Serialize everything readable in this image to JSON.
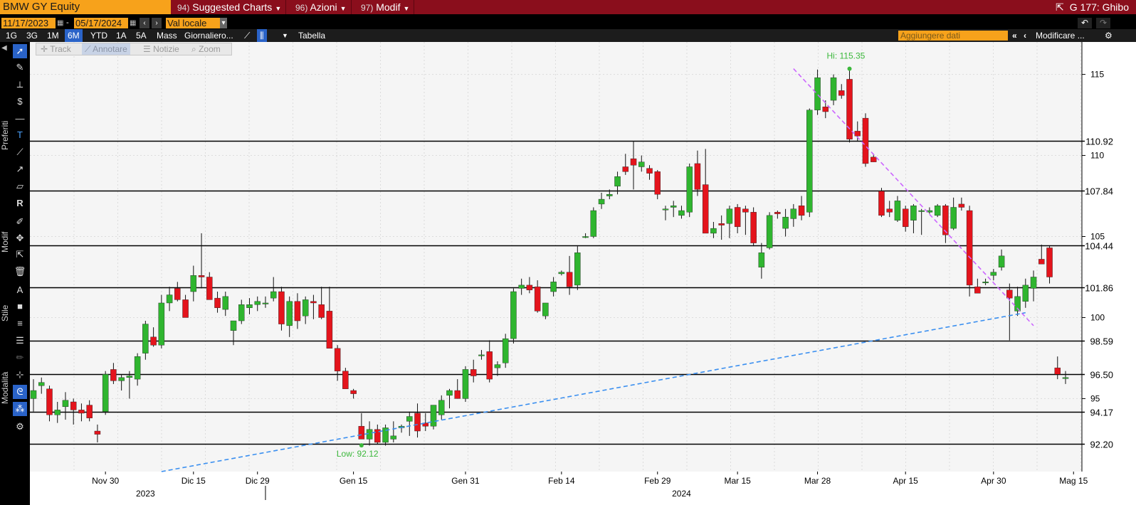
{
  "header": {
    "ticker": "BMW GY Equity",
    "menus": [
      {
        "num": "94)",
        "label": "Suggested Charts"
      },
      {
        "num": "96)",
        "label": "Azioni"
      },
      {
        "num": "97)",
        "label": "Modif"
      }
    ],
    "right_title": "G 177: Ghibo"
  },
  "range": {
    "start": "11/17/2023",
    "end": "05/17/2024",
    "currency": "Val locale"
  },
  "timeframes": [
    "1G",
    "3G",
    "1M",
    "6M",
    "YTD",
    "1A",
    "5A",
    "Mass"
  ],
  "active_timeframe": "6M",
  "periodicity": "Giornaliero...",
  "table_label": "Tabella",
  "add_data_placeholder": "Aggiungere dati",
  "modify_label": "Modificare ...",
  "float_toolbar": [
    "Track",
    "Annotare",
    "Notizie",
    "Zoom"
  ],
  "left_sections": [
    "Preferiti",
    "Modif",
    "Stile",
    "Modalità"
  ],
  "colors": {
    "up": "#2fb52f",
    "down": "#e4141c",
    "trend_down": "#cc66ff",
    "trend_up": "#3a8ff0",
    "hi_lo_label": "#3cb83c",
    "accent": "#f7a21b",
    "header_red": "#8a0e1c",
    "selected": "#2a63c8"
  },
  "chart_data": {
    "type": "candlestick",
    "y_range": [
      90.5,
      117
    ],
    "y_ticks": [
      95,
      100,
      105,
      110,
      115
    ],
    "x_ticks": [
      "Nov 30",
      "Dic 15",
      "Dic 29",
      "Gen 15",
      "Gen 31",
      "Feb 14",
      "Feb 29",
      "Mar 15",
      "Mar 28",
      "Apr 15",
      "Apr 30",
      "Mag 15"
    ],
    "years": [
      "2023",
      "2024"
    ],
    "hi_label": "Hi: 115.35",
    "lo_label": "Low: 92.12",
    "levels": [
      110.92,
      107.84,
      104.44,
      101.86,
      98.59,
      96.5,
      94.17,
      92.2
    ],
    "trendlines": [
      {
        "name": "resistance",
        "from": [
          95,
          115.35
        ],
        "to": [
          125,
          99.5
        ]
      },
      {
        "name": "support",
        "from": [
          16,
          90.5
        ],
        "to": [
          124,
          100.3
        ]
      }
    ],
    "candles": [
      [
        95.0,
        96.2,
        94.2,
        95.5
      ],
      [
        95.8,
        96.3,
        95.3,
        96.0
      ],
      [
        95.6,
        95.8,
        93.6,
        94.0
      ],
      [
        94.0,
        94.8,
        93.5,
        94.3
      ],
      [
        94.5,
        95.4,
        93.7,
        94.9
      ],
      [
        94.8,
        95.0,
        93.4,
        94.3
      ],
      [
        94.3,
        94.7,
        93.6,
        94.1
      ],
      [
        94.6,
        94.9,
        93.6,
        93.8
      ],
      [
        93.0,
        93.4,
        92.3,
        92.8
      ],
      [
        94.2,
        96.7,
        94.0,
        96.5
      ],
      [
        96.8,
        97.2,
        95.9,
        96.1
      ],
      [
        96.1,
        96.5,
        95.5,
        96.3
      ],
      [
        96.3,
        96.7,
        95.0,
        96.4
      ],
      [
        96.2,
        97.8,
        95.8,
        97.6
      ],
      [
        97.8,
        99.8,
        97.4,
        99.6
      ],
      [
        98.8,
        99.4,
        98.2,
        98.3
      ],
      [
        98.3,
        101.4,
        98.1,
        100.9
      ],
      [
        100.9,
        101.9,
        100.4,
        101.4
      ],
      [
        101.8,
        102.2,
        101.0,
        101.1
      ],
      [
        101.1,
        101.4,
        100.0,
        100.0
      ],
      [
        101.6,
        103.2,
        101.0,
        102.6
      ],
      [
        102.6,
        105.2,
        101.8,
        102.5
      ],
      [
        102.5,
        102.8,
        101.2,
        101.1
      ],
      [
        101.2,
        101.6,
        100.3,
        100.6
      ],
      [
        100.5,
        101.6,
        100.1,
        101.3
      ],
      [
        99.2,
        99.6,
        98.3,
        99.8
      ],
      [
        99.8,
        101.1,
        99.6,
        100.8
      ],
      [
        100.6,
        101.2,
        100.2,
        100.8
      ],
      [
        100.8,
        101.3,
        100.4,
        101.0
      ],
      [
        100.9,
        101.3,
        100.6,
        100.9
      ],
      [
        101.2,
        102.5,
        101.0,
        101.6
      ],
      [
        101.6,
        101.9,
        99.2,
        99.6
      ],
      [
        99.5,
        101.3,
        98.8,
        101.0
      ],
      [
        101.0,
        101.5,
        99.3,
        99.8
      ],
      [
        100.1,
        101.3,
        99.6,
        101.1
      ],
      [
        101.0,
        101.4,
        99.9,
        100.9
      ],
      [
        100.8,
        101.9,
        99.9,
        100.0
      ],
      [
        100.4,
        101.9,
        98.2,
        98.1
      ],
      [
        98.1,
        98.3,
        96.1,
        96.7
      ],
      [
        96.7,
        96.9,
        95.8,
        95.6
      ],
      [
        95.5,
        95.6,
        95.0,
        95.3
      ],
      [
        93.3,
        94.1,
        92.6,
        92.5
      ],
      [
        92.5,
        93.6,
        92.1,
        93.1
      ],
      [
        93.1,
        93.4,
        92.2,
        92.3
      ],
      [
        92.3,
        93.4,
        92.1,
        93.2
      ],
      [
        92.5,
        93.6,
        92.3,
        92.7
      ],
      [
        93.2,
        93.4,
        92.9,
        93.3
      ],
      [
        93.6,
        94.2,
        92.7,
        93.9
      ],
      [
        94.1,
        94.7,
        92.6,
        93.0
      ],
      [
        93.5,
        94.1,
        93.0,
        93.3
      ],
      [
        93.3,
        94.6,
        93.1,
        94.6
      ],
      [
        94.0,
        95.2,
        93.7,
        94.9
      ],
      [
        95.2,
        95.6,
        94.4,
        95.5
      ],
      [
        95.5,
        96.2,
        95.0,
        95.0
      ],
      [
        95.0,
        97.0,
        94.8,
        96.8
      ],
      [
        96.8,
        97.4,
        96.0,
        96.4
      ],
      [
        97.7,
        98.0,
        97.4,
        97.7
      ],
      [
        97.9,
        98.6,
        96.0,
        96.2
      ],
      [
        96.9,
        97.3,
        96.4,
        97.1
      ],
      [
        97.2,
        99.0,
        96.9,
        98.7
      ],
      [
        98.7,
        101.8,
        98.4,
        101.6
      ],
      [
        101.8,
        102.4,
        101.4,
        102.0
      ],
      [
        102.0,
        102.5,
        101.5,
        101.7
      ],
      [
        101.9,
        102.3,
        100.3,
        100.4
      ],
      [
        100.1,
        100.9,
        99.9,
        100.9
      ],
      [
        101.6,
        102.5,
        101.3,
        102.2
      ],
      [
        102.7,
        102.9,
        102.6,
        102.8
      ],
      [
        102.8,
        103.8,
        101.4,
        101.9
      ],
      [
        102.0,
        104.4,
        101.7,
        104.0
      ],
      [
        105.0,
        105.2,
        104.9,
        105.0
      ],
      [
        105.0,
        106.8,
        104.9,
        106.6
      ],
      [
        107.0,
        107.7,
        106.7,
        107.3
      ],
      [
        107.5,
        107.9,
        107.3,
        107.6
      ],
      [
        108.1,
        109.0,
        107.6,
        108.7
      ],
      [
        109.3,
        110.1,
        108.8,
        109.0
      ],
      [
        109.8,
        110.9,
        107.9,
        109.4
      ],
      [
        109.3,
        110.0,
        109.0,
        109.6
      ],
      [
        109.2,
        109.4,
        108.5,
        108.9
      ],
      [
        109.0,
        109.1,
        107.3,
        107.6
      ],
      [
        106.7,
        106.9,
        106.0,
        106.7
      ],
      [
        106.8,
        107.2,
        106.2,
        106.9
      ],
      [
        106.3,
        106.9,
        106.1,
        106.6
      ],
      [
        106.5,
        109.5,
        106.2,
        109.3
      ],
      [
        109.5,
        110.3,
        107.5,
        107.9
      ],
      [
        108.2,
        110.4,
        105.9,
        105.2
      ],
      [
        105.2,
        105.9,
        104.9,
        105.5
      ],
      [
        105.8,
        106.3,
        104.8,
        105.7
      ],
      [
        105.8,
        106.9,
        104.9,
        106.7
      ],
      [
        106.8,
        107.0,
        105.2,
        105.6
      ],
      [
        106.7,
        106.9,
        105.1,
        106.5
      ],
      [
        106.5,
        106.8,
        104.4,
        104.6
      ],
      [
        103.1,
        104.6,
        102.4,
        104.0
      ],
      [
        104.3,
        106.5,
        104.2,
        106.3
      ],
      [
        106.5,
        106.6,
        106.1,
        106.4
      ],
      [
        105.5,
        106.7,
        105.0,
        106.2
      ],
      [
        106.1,
        107.0,
        105.6,
        106.7
      ],
      [
        106.9,
        107.5,
        106.0,
        106.3
      ],
      [
        106.5,
        112.9,
        106.2,
        112.8
      ],
      [
        112.8,
        115.3,
        112.5,
        114.8
      ],
      [
        113.0,
        113.4,
        112.3,
        112.7
      ],
      [
        113.4,
        115.0,
        113.1,
        114.8
      ],
      [
        114.0,
        114.4,
        113.5,
        113.7
      ],
      [
        114.7,
        115.35,
        110.8,
        111.0
      ],
      [
        111.5,
        112.1,
        110.9,
        111.2
      ],
      [
        112.3,
        112.6,
        109.3,
        109.5
      ],
      [
        109.9,
        110.1,
        109.6,
        109.6
      ],
      [
        107.8,
        108.0,
        106.2,
        106.3
      ],
      [
        106.7,
        107.2,
        106.2,
        106.5
      ],
      [
        106.0,
        107.5,
        105.9,
        107.2
      ],
      [
        106.7,
        106.9,
        105.3,
        105.6
      ],
      [
        106.0,
        107.0,
        105.2,
        106.9
      ],
      [
        106.6,
        106.7,
        105.1,
        106.6
      ],
      [
        106.5,
        106.8,
        106.4,
        106.6
      ],
      [
        106.3,
        107.0,
        106.2,
        106.9
      ],
      [
        106.9,
        107.0,
        104.6,
        105.1
      ],
      [
        105.5,
        107.4,
        105.4,
        106.8
      ],
      [
        107.0,
        107.4,
        106.6,
        106.8
      ],
      [
        106.6,
        106.9,
        101.3,
        102.0
      ],
      [
        101.9,
        102.4,
        101.7,
        101.5
      ],
      [
        102.2,
        102.4,
        102.0,
        102.2
      ],
      [
        102.6,
        103.0,
        102.3,
        102.8
      ],
      [
        103.1,
        104.2,
        102.9,
        103.8
      ],
      [
        101.7,
        102.1,
        98.6,
        101.2
      ],
      [
        100.4,
        101.9,
        100.1,
        101.3
      ],
      [
        101.0,
        102.4,
        100.6,
        102.0
      ],
      [
        101.8,
        102.9,
        101.0,
        102.5
      ],
      [
        103.6,
        104.5,
        103.3,
        103.3
      ],
      [
        104.3,
        104.4,
        102.1,
        102.5
      ],
      [
        96.9,
        97.6,
        96.2,
        96.5
      ],
      [
        96.3,
        96.7,
        95.9,
        96.3
      ]
    ]
  }
}
